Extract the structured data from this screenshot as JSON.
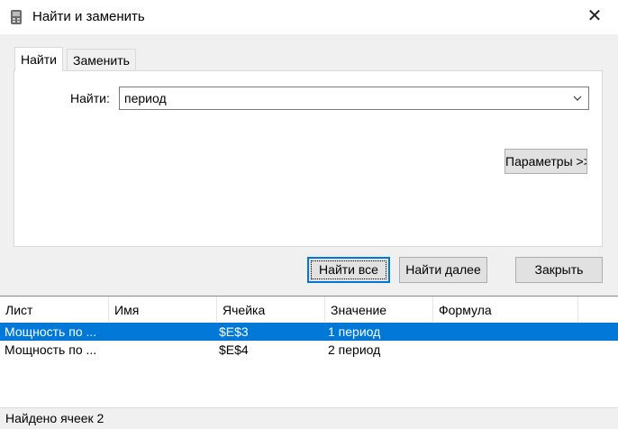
{
  "window": {
    "title": "Найти и заменить",
    "close_icon": "close-icon",
    "app_icon": "app-icon"
  },
  "tabs": [
    {
      "label": "Найти",
      "active": true
    },
    {
      "label": "Заменить",
      "active": false
    }
  ],
  "find": {
    "label": "Найти:",
    "value": "период"
  },
  "options_button": {
    "label": "Параметры >>"
  },
  "buttons": {
    "find_all": "Найти все",
    "find_next": "Найти далее",
    "close": "Закрыть"
  },
  "results": {
    "columns": [
      "Лист",
      "Имя",
      "Ячейка",
      "Значение",
      "Формула"
    ],
    "rows": [
      {
        "sheet": "Мощность по ...",
        "name": "",
        "cell": "$E$3",
        "value": "1 период",
        "formula": "",
        "selected": true
      },
      {
        "sheet": "Мощность по ...",
        "name": "",
        "cell": "$E$4",
        "value": "2 период",
        "formula": "",
        "selected": false
      }
    ]
  },
  "status": {
    "text": "Найдено ячеек 2"
  },
  "colors": {
    "accent": "#0078d7"
  }
}
